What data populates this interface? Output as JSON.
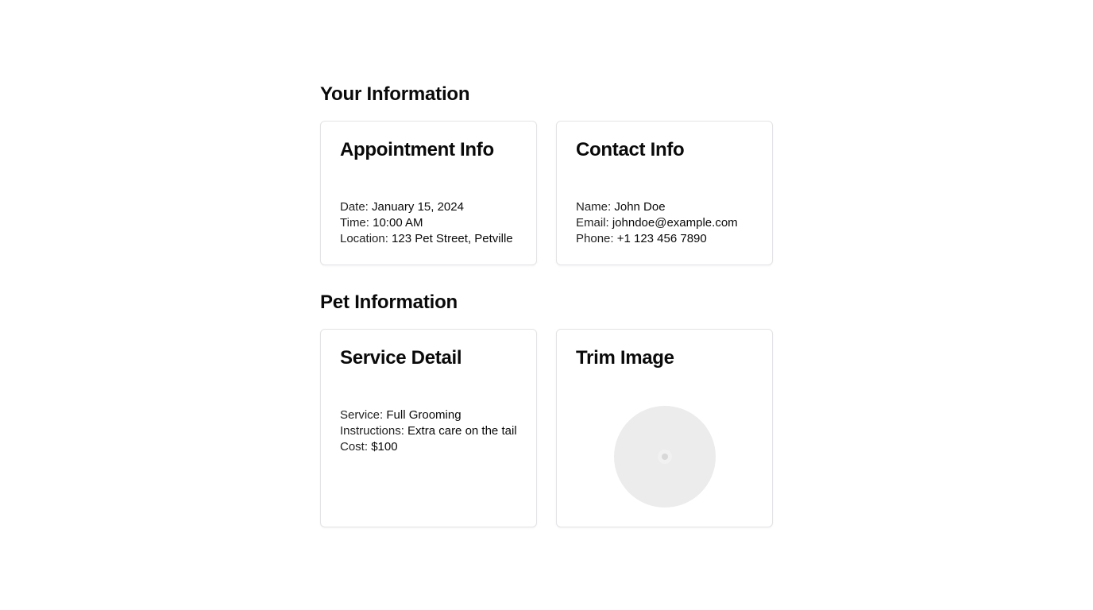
{
  "your_information": {
    "heading": "Your Information",
    "appointment": {
      "title": "Appointment Info",
      "date_label": "Date: ",
      "date_value": "January 15, 2024",
      "time_label": "Time: ",
      "time_value": "10:00 AM",
      "location_label": "Location: ",
      "location_value": "123 Pet Street, Petville"
    },
    "contact": {
      "title": "Contact Info",
      "name_label": "Name: ",
      "name_value": "John Doe",
      "email_label": "Email: ",
      "email_value": "johndoe@example.com",
      "phone_label": "Phone: ",
      "phone_value": "+1 123 456 7890"
    }
  },
  "pet_information": {
    "heading": "Pet Information",
    "service": {
      "title": "Service Detail",
      "service_label": "Service: ",
      "service_value": "Full Grooming",
      "instructions_label": "Instructions: ",
      "instructions_value": "Extra care on the tail",
      "cost_label": "Cost: ",
      "cost_value": "$100"
    },
    "trim_image": {
      "title": "Trim Image",
      "image_icon": "image-placeholder-icon"
    }
  }
}
